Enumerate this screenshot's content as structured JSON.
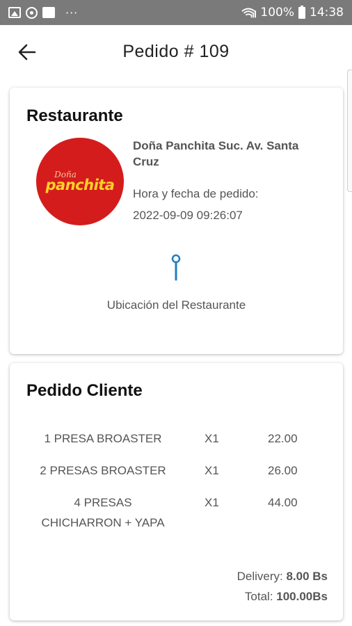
{
  "status_bar": {
    "icons_left": [
      "gallery-icon",
      "sync-icon",
      "app-icon"
    ],
    "overflow": "···",
    "battery_percent": "100%",
    "time": "14:38"
  },
  "app_bar": {
    "back_icon": "arrow-left-icon",
    "title": "Pedido # 109"
  },
  "restaurant_card": {
    "heading": "Restaurante",
    "logo": {
      "top_text": "Doña",
      "main_text": "panchita",
      "bg_color": "#d41c1c"
    },
    "name": "Doña Panchita Suc. Av. Santa Cruz",
    "order_time_label": "Hora y fecha de pedido:",
    "order_time_value": "2022-09-09 09:26:07",
    "location_icon": "map-pin-icon",
    "location_label": "Ubicación del Restaurante"
  },
  "order_card": {
    "heading": "Pedido Cliente",
    "items": [
      {
        "name": "1 PRESA BROASTER",
        "qty": "X1",
        "price": "22.00"
      },
      {
        "name": "2 PRESAS BROASTER",
        "qty": "X1",
        "price": "26.00"
      },
      {
        "name": "4 PRESAS CHICHARRON + YAPA",
        "qty": "X1",
        "price": "44.00"
      }
    ],
    "delivery_label": "Delivery:",
    "delivery_value": "8.00 Bs",
    "total_label": "Total:",
    "total_value": "100.00Bs"
  },
  "colors": {
    "status_bar": "#7a7a7a",
    "pin": "#1f7fbd",
    "text_secondary": "#555555"
  }
}
